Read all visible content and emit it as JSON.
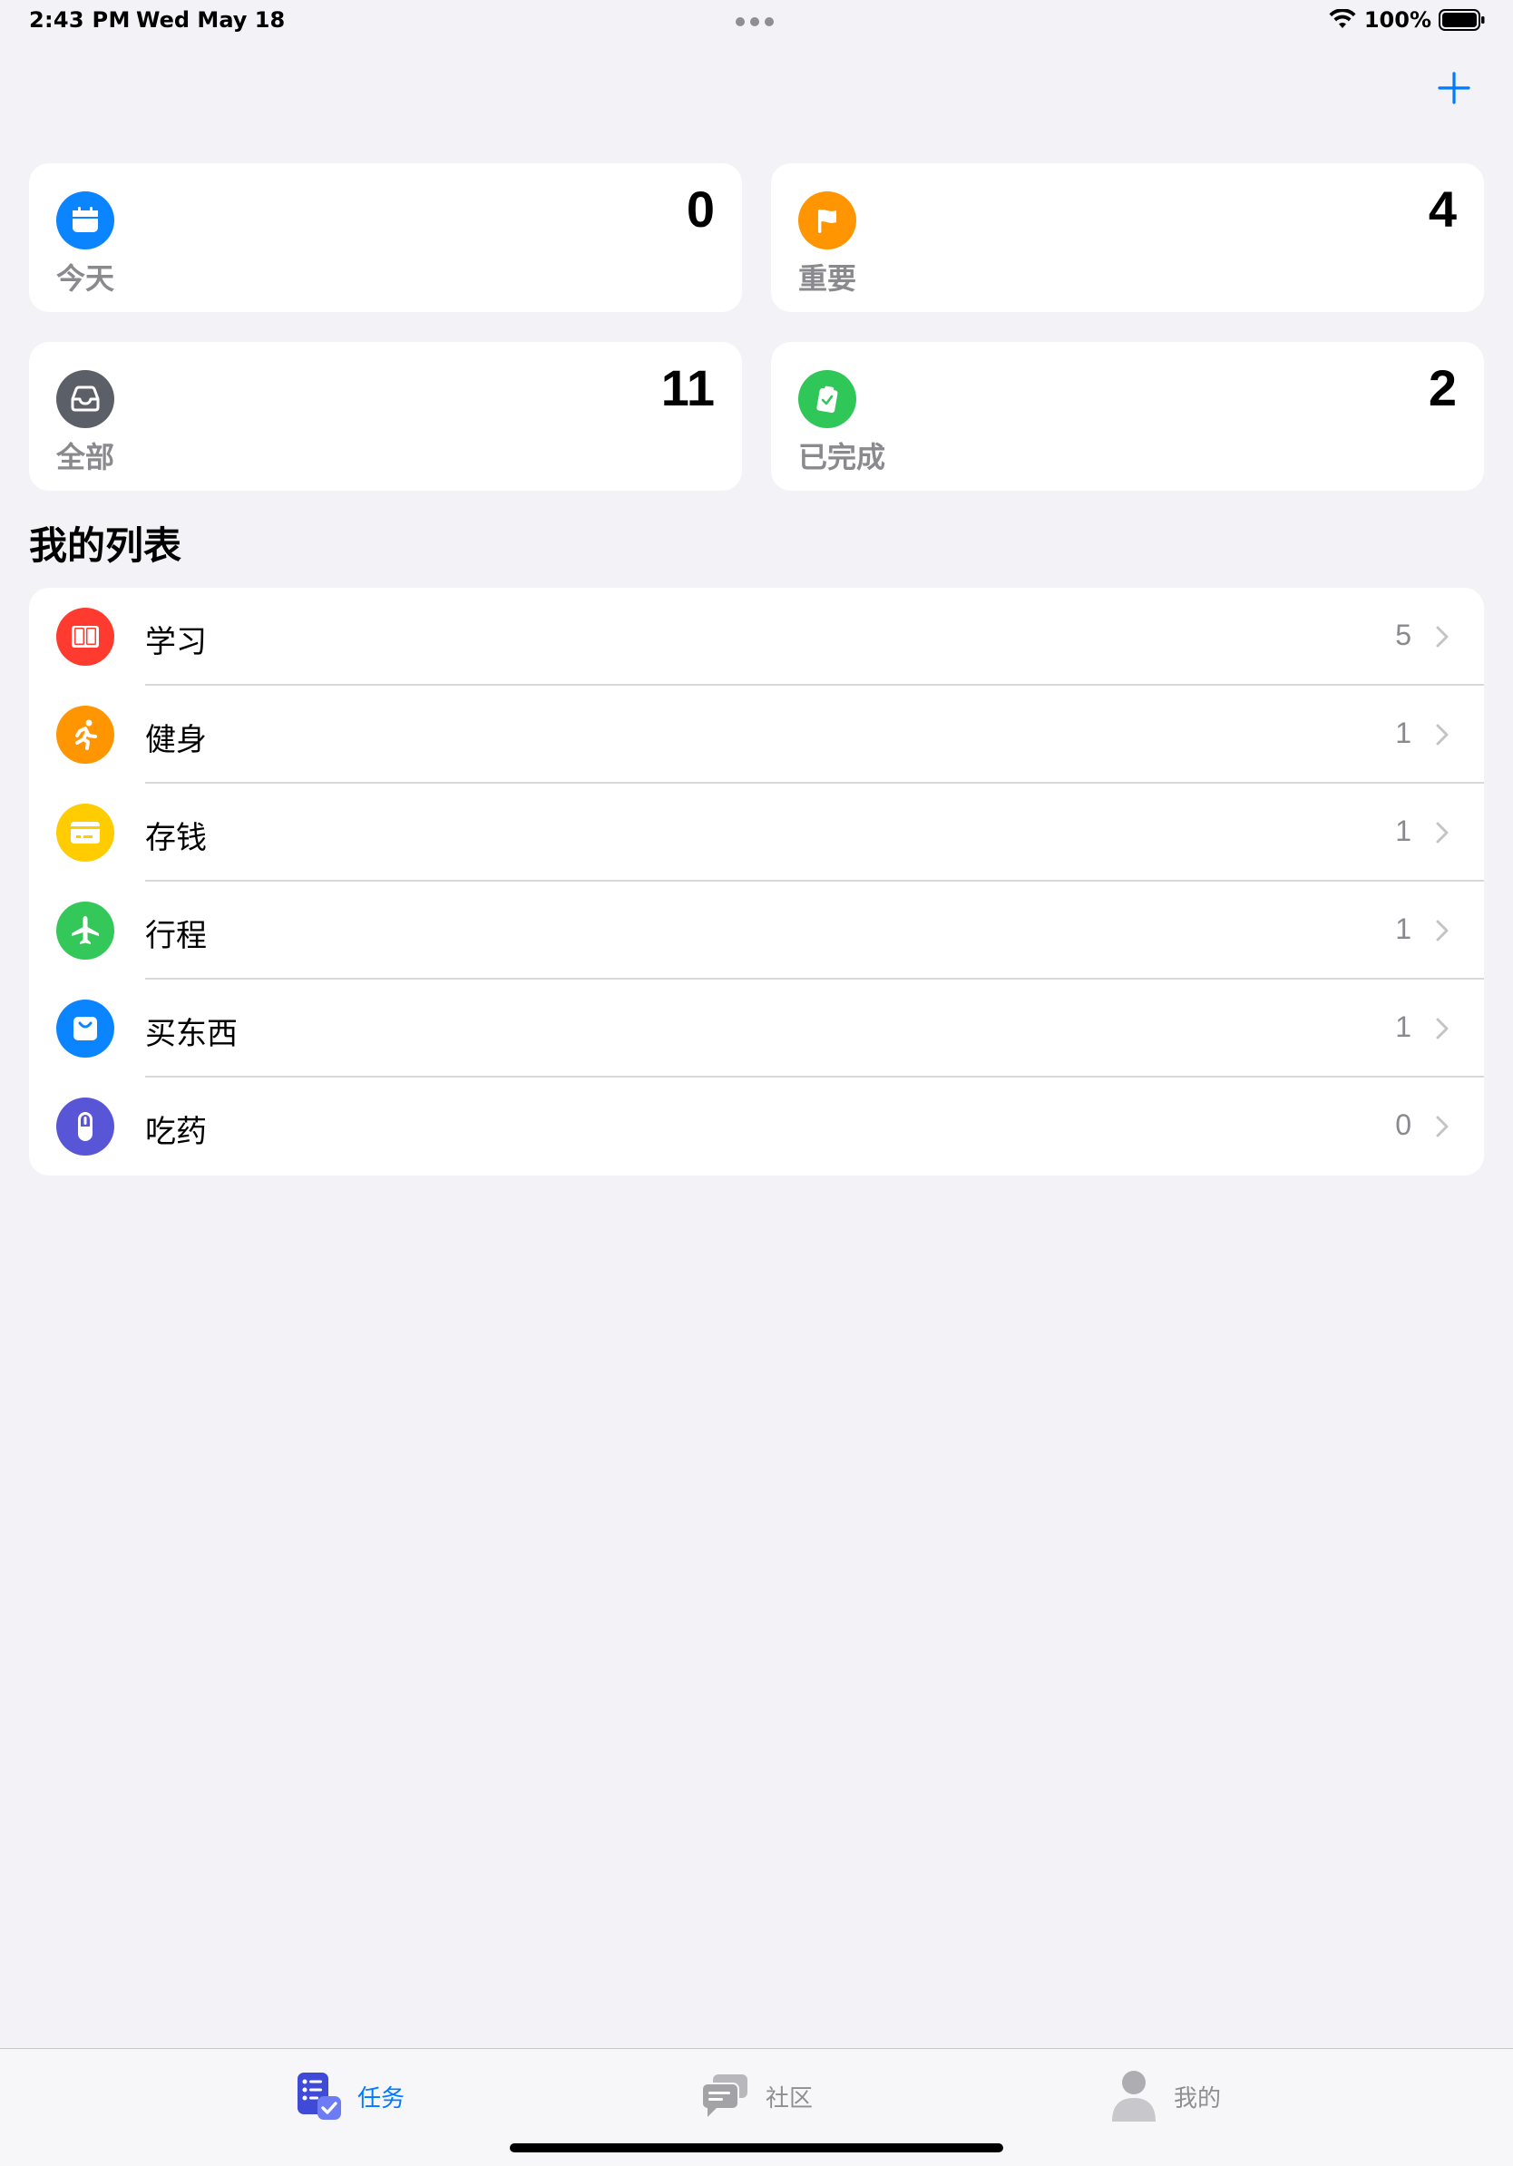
{
  "status_bar": {
    "time": "2:43 PM",
    "date": "Wed May 18",
    "battery_percent": "100%"
  },
  "header": {
    "add_icon": "plus-icon",
    "accent_color": "#007aff"
  },
  "summary_cards": [
    {
      "label": "今天",
      "count": "0",
      "icon": "calendar-icon",
      "color": "#0a84ff"
    },
    {
      "label": "重要",
      "count": "4",
      "icon": "flag-icon",
      "color": "#ff9500"
    },
    {
      "label": "全部",
      "count": "11",
      "icon": "tray-icon",
      "color": "#5b6068"
    },
    {
      "label": "已完成",
      "count": "2",
      "icon": "clipboard-check-icon",
      "color": "#30c759"
    }
  ],
  "my_lists": {
    "title": "我的列表",
    "items": [
      {
        "label": "学习",
        "count": "5",
        "icon": "book-icon",
        "color": "#ff3b30"
      },
      {
        "label": "健身",
        "count": "1",
        "icon": "running-icon",
        "color": "#ff9500"
      },
      {
        "label": "存钱",
        "count": "1",
        "icon": "card-icon",
        "color": "#ffcc00"
      },
      {
        "label": "行程",
        "count": "1",
        "icon": "airplane-icon",
        "color": "#34c759"
      },
      {
        "label": "买东西",
        "count": "1",
        "icon": "bag-icon",
        "color": "#0a84ff"
      },
      {
        "label": "吃药",
        "count": "0",
        "icon": "pill-icon",
        "color": "#5856d6"
      }
    ]
  },
  "tab_bar": {
    "tabs": [
      {
        "label": "任务",
        "icon": "tasks-icon",
        "active": true
      },
      {
        "label": "社区",
        "icon": "chat-icon",
        "active": false
      },
      {
        "label": "我的",
        "icon": "person-icon",
        "active": false
      }
    ],
    "active_color": "#007aff",
    "inactive_color": "#8e8e93"
  }
}
